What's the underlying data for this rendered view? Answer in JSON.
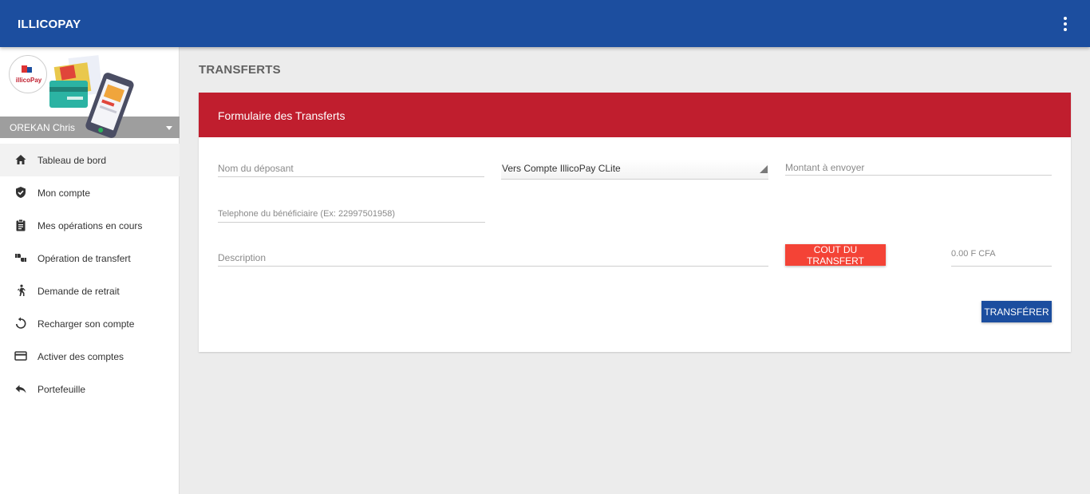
{
  "app": {
    "title": "ILLICOPAY"
  },
  "user": {
    "name": "OREKAN Chris"
  },
  "logo": {
    "text": "illicoPay"
  },
  "sidebar": {
    "items": [
      {
        "label": "Tableau de bord",
        "icon": "home-icon"
      },
      {
        "label": "Mon compte",
        "icon": "shield-check-icon"
      },
      {
        "label": "Mes opérations en cours",
        "icon": "clipboard-icon"
      },
      {
        "label": "Opération de transfert",
        "icon": "thumbs-transfer-icon"
      },
      {
        "label": "Demande de retrait",
        "icon": "walking-person-icon"
      },
      {
        "label": "Recharger son compte",
        "icon": "refresh-icon"
      },
      {
        "label": "Activer des comptes",
        "icon": "credit-card-icon"
      },
      {
        "label": "Portefeuille",
        "icon": "reply-icon"
      }
    ]
  },
  "page": {
    "title": "TRANSFERTS"
  },
  "form": {
    "title": "Formulaire des Transferts",
    "depositor_placeholder": "Nom du déposant",
    "account_selected": "Vers Compte IllicoPay CLite",
    "amount_placeholder": "Montant à envoyer",
    "phone_placeholder": "Telephone du bénéficiaire (Ex: 22997501958)",
    "description_placeholder": "Description",
    "cost_button": "COUT DU TRANSFERT",
    "cost_value": "0.00 F CFA",
    "submit_button": "TRANSFÉRER"
  },
  "colors": {
    "primary": "#1c4e9f",
    "header_red": "#c01e2e",
    "cost_red": "#f44336",
    "user_bar": "#9e9e9e"
  }
}
